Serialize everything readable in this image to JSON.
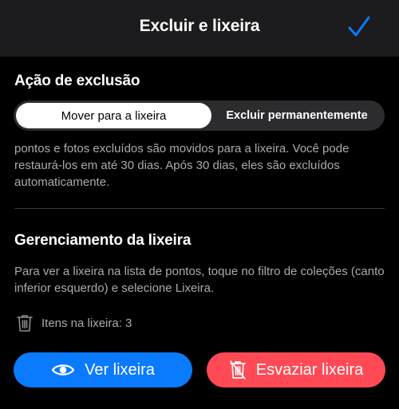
{
  "header": {
    "title": "Excluir e lixeira"
  },
  "deletion_action": {
    "title": "Ação de exclusão",
    "options": [
      {
        "label": "Mover para a lixeira",
        "selected": true
      },
      {
        "label": "Excluir permanentemente",
        "selected": false
      }
    ],
    "description": "pontos e fotos excluídos são movidos para a lixeira. Você pode restaurá-los em até 30 dias. Após 30 dias, eles são excluídos automaticamente."
  },
  "trash_management": {
    "title": "Gerenciamento da lixeira",
    "description": "Para ver a lixeira na lista de pontos, toque no filtro de coleções (canto inferior esquerdo) e selecione Lixeira.",
    "items_label": "Itens na lixeira: 3",
    "view_button": "Ver lixeira",
    "empty_button": "Esvaziar lixeira"
  },
  "colors": {
    "accent_blue": "#0a7aff",
    "destructive_red": "#ff4a55",
    "header_bg": "#1c1c1e",
    "segment_bg": "#2c2c2e",
    "secondary_text": "#ababb0"
  }
}
